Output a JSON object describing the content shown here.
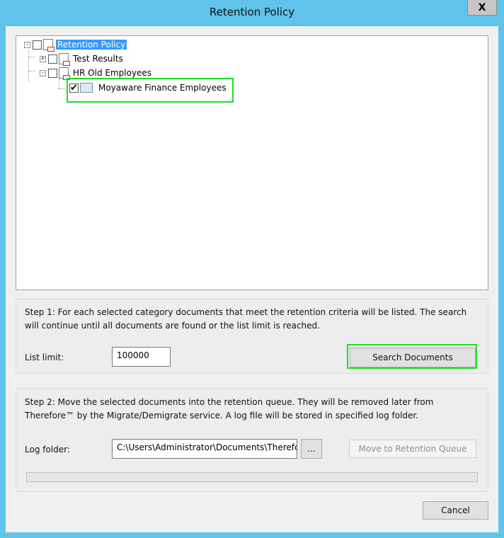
{
  "window": {
    "title": "Retention Policy",
    "close_glyph": "X"
  },
  "tree": {
    "root": {
      "label": "Retention Policy",
      "expander": "-",
      "selected": true
    },
    "children": [
      {
        "label": "Test Results",
        "expander": "+"
      },
      {
        "label": "HR Old Employees",
        "expander": "-",
        "children": [
          {
            "label": "Moyaware Finance Employees",
            "checked": true,
            "check_glyph": "✔"
          }
        ]
      }
    ]
  },
  "step1": {
    "description": "Step 1: For each selected category documents that meet the retention criteria will be listed. The search will continue until all documents are found or the list limit is reached.",
    "list_limit_label": "List limit:",
    "list_limit_value": "100000",
    "search_button": "Search Documents"
  },
  "step2": {
    "description": "Step 2: Move the selected documents into the retention queue. They will be removed later from Therefore™ by the Migrate/Demigrate service. A log file will be stored in specified log folder.",
    "log_folder_label": "Log folder:",
    "log_folder_value": "C:\\Users\\Administrator\\Documents\\Therefore",
    "browse_button": "...",
    "move_button": "Move to Retention Queue",
    "progress": 0
  },
  "footer": {
    "cancel_button": "Cancel"
  },
  "colors": {
    "title_bar": "#5fc3ea",
    "selection": "#3399ff",
    "highlight": "#22dd22"
  }
}
